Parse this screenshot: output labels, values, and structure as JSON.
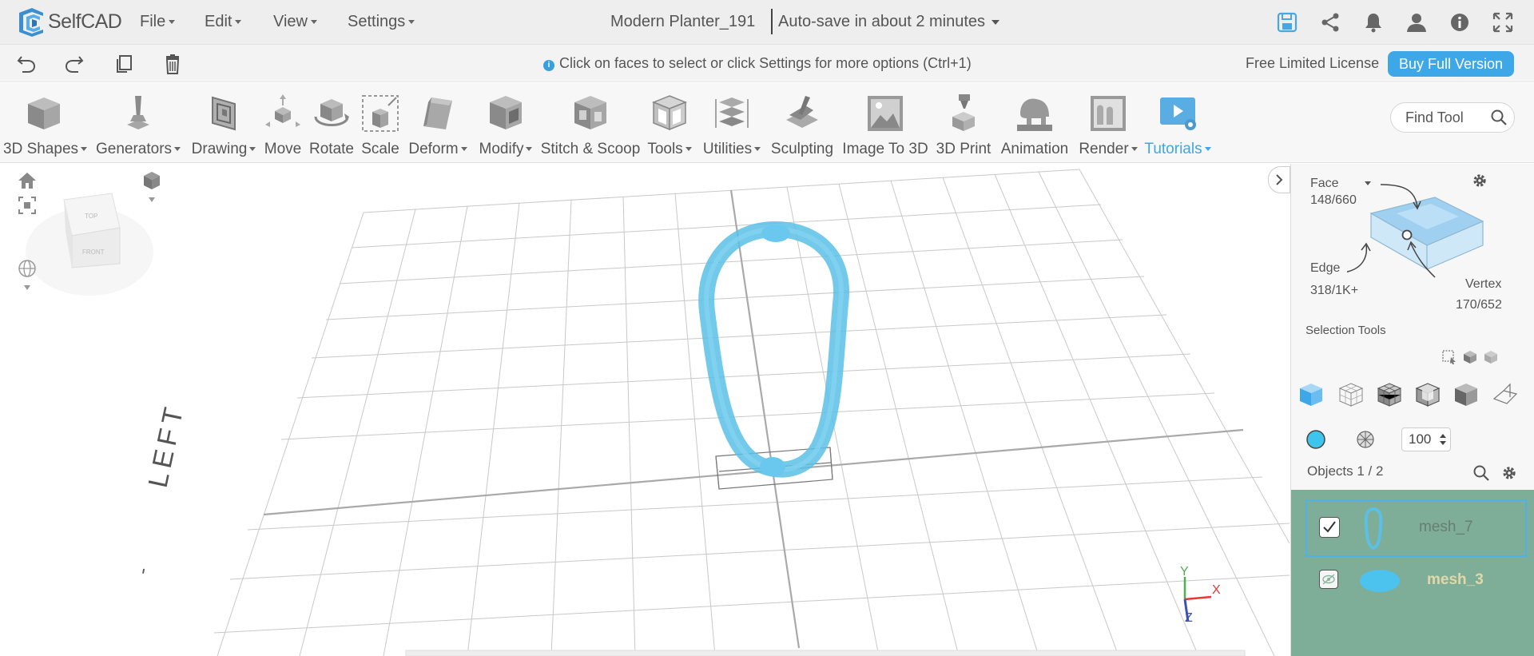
{
  "app": {
    "logo_text": "SelfCAD",
    "document_title": "Modern Planter_191",
    "autosave_text": "Auto-save in about 2 minutes"
  },
  "menu": [
    {
      "label": "File"
    },
    {
      "label": "Edit"
    },
    {
      "label": "View"
    },
    {
      "label": "Settings"
    }
  ],
  "hint_bar": {
    "hint": "Click on faces to select or click Settings for more options (Ctrl+1)",
    "license": "Free Limited License",
    "buy_label": "Buy Full Version"
  },
  "toolbar": [
    {
      "label": "3D Shapes",
      "icon": "cube-icon",
      "dropdown": true
    },
    {
      "label": "Generators",
      "icon": "generator-icon",
      "dropdown": true
    },
    {
      "label": "Drawing",
      "icon": "drawing-icon",
      "dropdown": true
    },
    {
      "label": "Move",
      "icon": "move-icon",
      "dropdown": false
    },
    {
      "label": "Rotate",
      "icon": "rotate-icon",
      "dropdown": false
    },
    {
      "label": "Scale",
      "icon": "scale-icon",
      "dropdown": false
    },
    {
      "label": "Deform",
      "icon": "deform-icon",
      "dropdown": true
    },
    {
      "label": "Modify",
      "icon": "modify-icon",
      "dropdown": true
    },
    {
      "label": "Stitch & Scoop",
      "icon": "stitch-scoop-icon",
      "dropdown": false
    },
    {
      "label": "Tools",
      "icon": "tools-icon",
      "dropdown": true
    },
    {
      "label": "Utilities",
      "icon": "utilities-icon",
      "dropdown": true
    },
    {
      "label": "Sculpting",
      "icon": "sculpting-icon",
      "dropdown": false
    },
    {
      "label": "Image To 3D",
      "icon": "image-to-3d-icon",
      "dropdown": false
    },
    {
      "label": "3D Print",
      "icon": "3d-print-icon",
      "dropdown": false
    },
    {
      "label": "Animation",
      "icon": "animation-icon",
      "dropdown": false
    },
    {
      "label": "Render",
      "icon": "render-icon",
      "dropdown": true
    },
    {
      "label": "Tutorials",
      "icon": "tutorials-icon",
      "dropdown": true
    }
  ],
  "find_tool": {
    "label": "Find Tool"
  },
  "viewport": {
    "view_cube": {
      "top": "TOP",
      "front": "FRONT"
    },
    "side_label": "LEFT",
    "axes": {
      "x": "X",
      "y": "Y",
      "z": "Z"
    }
  },
  "selection_panel": {
    "face_label": "Face",
    "face_count": "148/660",
    "edge_label": "Edge",
    "edge_count": "318/1K+",
    "vertex_label": "Vertex",
    "vertex_count": "170/652",
    "selection_tools_label": "Selection Tools",
    "brush_size": "100"
  },
  "objects_panel": {
    "header": "Objects 1 / 2",
    "items": [
      {
        "name": "mesh_7",
        "selected": true,
        "visible": true
      },
      {
        "name": "mesh_3",
        "selected": false,
        "visible": false
      }
    ]
  },
  "colors": {
    "accent": "#3ea7e8",
    "mesh": "#5bbfe6",
    "objects_bg": "#7fae98",
    "hidden_name": "#e0d8a8"
  }
}
